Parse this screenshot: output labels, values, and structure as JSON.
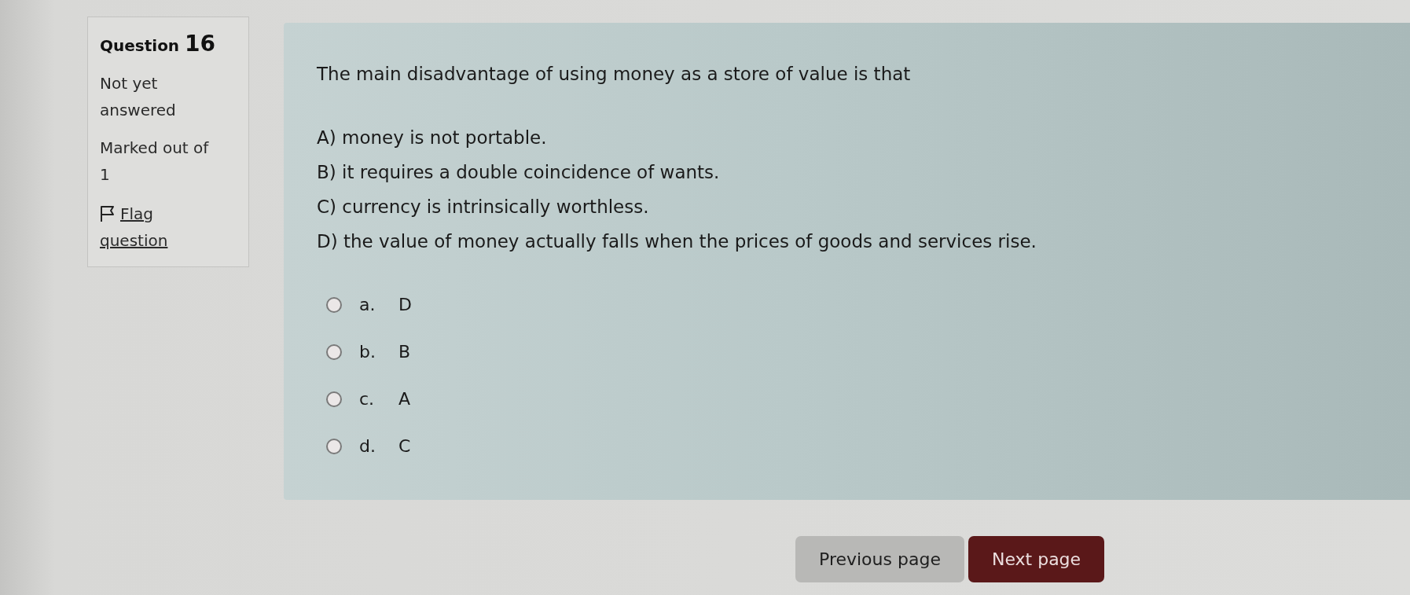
{
  "question_info": {
    "label": "Question",
    "number": "16",
    "state": "Not yet answered",
    "marks": "Marked out of 1",
    "flag_link": "Flag question"
  },
  "question": {
    "text": "The main disadvantage of using money as a store of value is that",
    "options": [
      "A) money is not portable.",
      "B) it requires a double coincidence of wants.",
      "C) currency is intrinsically worthless.",
      "D) the value of money actually falls when the prices of goods and services rise."
    ]
  },
  "answers": [
    {
      "letter": "a.",
      "text": "D",
      "selected": false
    },
    {
      "letter": "b.",
      "text": "B",
      "selected": false
    },
    {
      "letter": "c.",
      "text": "A",
      "selected": false
    },
    {
      "letter": "d.",
      "text": "C",
      "selected": false
    }
  ],
  "navigation": [
    {
      "label": "Previous page",
      "kind": "secondary"
    },
    {
      "label": "Next page",
      "kind": "primary"
    }
  ]
}
